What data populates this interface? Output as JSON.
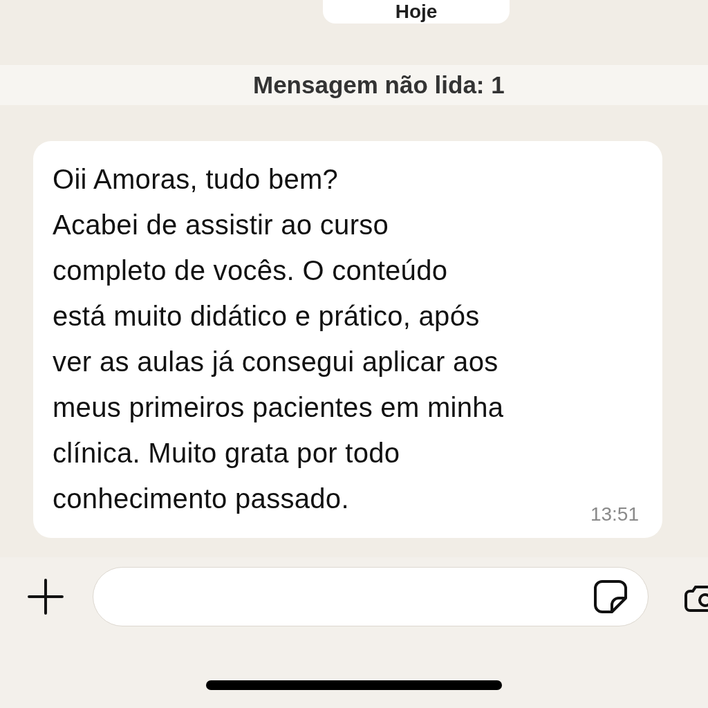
{
  "date_chip": "Hoje",
  "unread_banner": "Mensagem não lida: 1",
  "message": {
    "lines": [
      "Oii Amoras, tudo bem?",
      "Acabei de assistir ao curso",
      "completo de vocês. O conteúdo",
      "está muito didático e prático, após",
      "ver as aulas já consegui aplicar aos",
      "meus primeiros pacientes em minha",
      "clínica. Muito grata por todo",
      "conhecimento passado."
    ],
    "time": "13:51"
  }
}
